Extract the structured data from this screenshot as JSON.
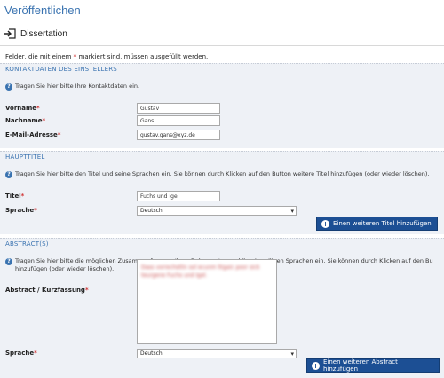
{
  "page": {
    "title": "Veröffentlichen",
    "document_type": "Dissertation",
    "required_note_prefix": "Felder, die mit einem ",
    "required_note_star": "*",
    "required_note_suffix": " markiert sind, müssen ausgefüllt werden."
  },
  "kontakt": {
    "heading": "KONTAKTDATEN DES EINSTELLERS",
    "hint": "Tragen Sie hier bitte Ihre Kontaktdaten ein.",
    "fields": [
      {
        "label": "Vorname",
        "value": "Gustav"
      },
      {
        "label": "Nachname",
        "value": "Gans"
      },
      {
        "label": "E-Mail-Adresse",
        "value": "gustav.gans@xyz.de"
      }
    ]
  },
  "haupttitel": {
    "heading": "HAUPTTITEL",
    "hint": "Tragen Sie hier bitte den Titel und seine Sprachen ein. Sie können durch Klicken auf den Button weitere Titel hinzufügen (oder wieder löschen).",
    "title_label": "Titel",
    "title_value": "Fuchs und Igel",
    "language_label": "Sprache",
    "language_value": "Deutsch",
    "add_button": "Einen weiteren Titel hinzufügen"
  },
  "abstract": {
    "heading": "ABSTRACT(S)",
    "hint_line1": "Tragen Sie hier bitte die möglichen Zusammenfassung Ihres Dokumentes und ihre jeweiligen Sprachen ein. Sie können durch Klicken auf den Bu",
    "hint_line2": "hinzufügen (oder wieder löschen).",
    "abstract_label": "Abstract / Kurzfassung",
    "abstract_value": "Dass vorrechstlin sol ecunm ltigaic poor sick teurgene Fuchs und Igel.",
    "language_label": "Sprache",
    "language_value": "Deutsch",
    "add_button": "Einen weiteren Abstract hinzufügen"
  },
  "icons": {
    "document_type": "arrow-into-document-icon",
    "info": "info-icon",
    "add": "plus-circle-icon",
    "dropdown": "chevron-down-icon"
  },
  "colors": {
    "title_blue": "#3a73b0",
    "section_background": "#eef1f6",
    "button_blue": "#1c4f94",
    "required_red": "#d03030"
  }
}
